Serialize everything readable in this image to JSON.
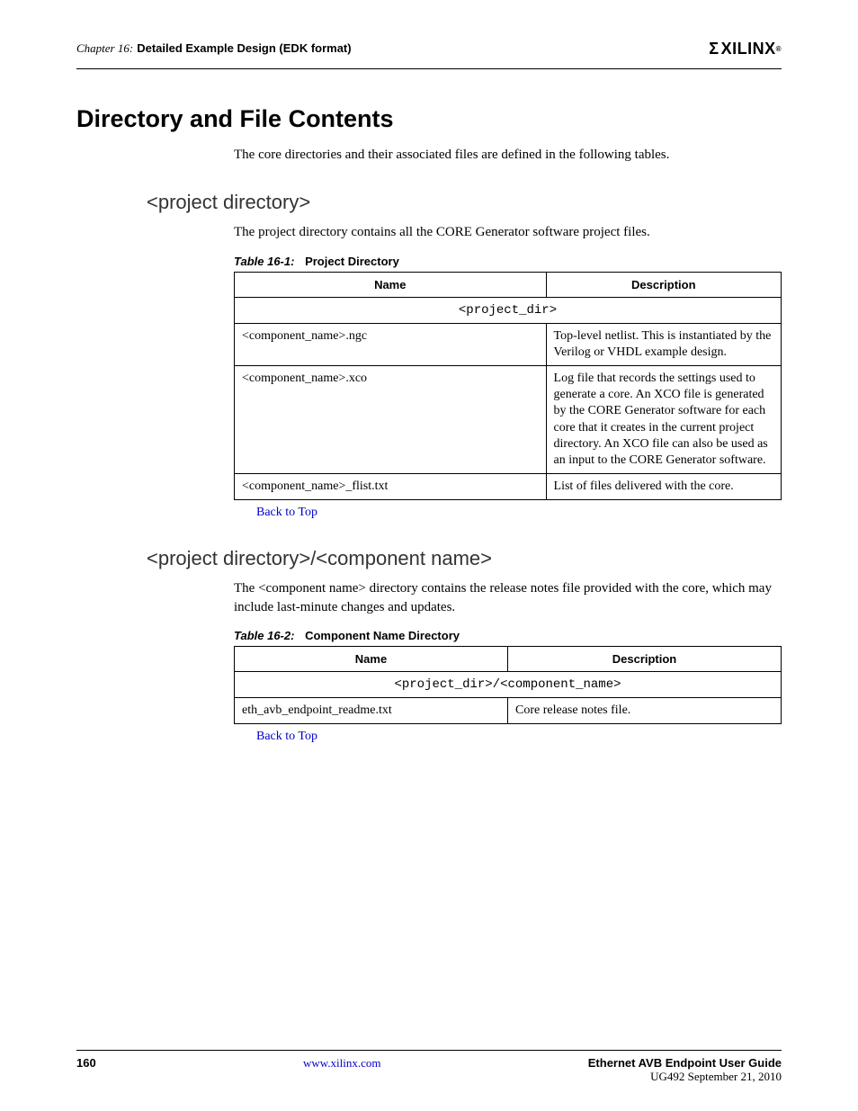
{
  "header": {
    "chapter_prefix": "Chapter 16:",
    "chapter_title": "Detailed Example Design (EDK format)",
    "logo_text": "XILINX"
  },
  "section": {
    "title": "Directory and File Contents",
    "intro": "The core directories and their associated files are defined in the following tables."
  },
  "sub1": {
    "heading": "<project directory>",
    "intro": "The project directory contains all the CORE Generator software project files.",
    "table_caption_prefix": "Table 16-1:",
    "table_caption_title": "Project Directory",
    "col_name": "Name",
    "col_desc": "Description",
    "spanrow": "<project_dir>",
    "rows": [
      {
        "name": "<component_name>.ngc",
        "desc": "Top-level netlist. This is instantiated by the Verilog or VHDL example design."
      },
      {
        "name": "<component_name>.xco",
        "desc": "Log file that records the settings used to generate a core. An XCO file is generated by the CORE Generator software for each core that it creates in the current project directory. An XCO file can also be used as an input to the CORE Generator software."
      },
      {
        "name": "<component_name>_flist.txt",
        "desc": "List of files delivered with the core."
      }
    ],
    "back_link": "Back to Top"
  },
  "sub2": {
    "heading": "<project directory>/<component name>",
    "intro": "The <component name> directory contains the release notes file provided with the core, which may include last-minute changes and updates.",
    "table_caption_prefix": "Table 16-2:",
    "table_caption_title": "Component Name Directory",
    "col_name": "Name",
    "col_desc": "Description",
    "spanrow": "<project_dir>/<component_name>",
    "rows": [
      {
        "name": "eth_avb_endpoint_readme.txt",
        "desc": "Core release notes file."
      }
    ],
    "back_link": "Back to Top"
  },
  "footer": {
    "page": "160",
    "url": "www.xilinx.com",
    "guide": "Ethernet AVB Endpoint User Guide",
    "date": "UG492 September 21, 2010"
  }
}
